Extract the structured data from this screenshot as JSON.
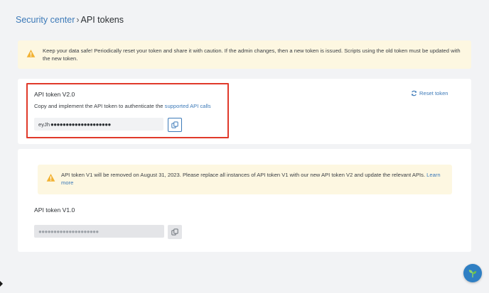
{
  "breadcrumb": {
    "parent": "Security center",
    "separator": "›",
    "current": "API tokens"
  },
  "warning_banner": {
    "icon": "warning-icon",
    "text": "Keep your data safe! Periodically reset your token and share it with caution. If the admin changes, then a new token is issued. Scripts using the old token must be updated with the new token."
  },
  "token_v2": {
    "title": "API token V2.0",
    "description": "Copy and implement the API token to authenticate the ",
    "link_text": "supported API calls",
    "token_prefix": "eyJh",
    "token_mask": "●●●●●●●●●●●●●●●●●●●●",
    "copy_icon": "copy-icon",
    "reset_label": "Reset token",
    "reset_icon": "refresh-icon"
  },
  "token_v1": {
    "notice_icon": "warning-icon",
    "notice_text": "API token V1 will be removed on August 31, 2023. Please replace all instances of API token V1 with our new API token V2 and update the relevant APIs. ",
    "notice_link": "Learn more",
    "title": "API token V1.0",
    "token_mask": "●●●●●●●●●●●●●●●●●●●●",
    "copy_icon": "copy-icon"
  },
  "help_fab": {
    "icon": "sprout-icon"
  },
  "colors": {
    "accent": "#3d7ab8",
    "warning_bg": "#fdf7e1",
    "warning_icon": "#f2b233",
    "highlight": "#e0392a",
    "fab": "#2f7fc3"
  }
}
